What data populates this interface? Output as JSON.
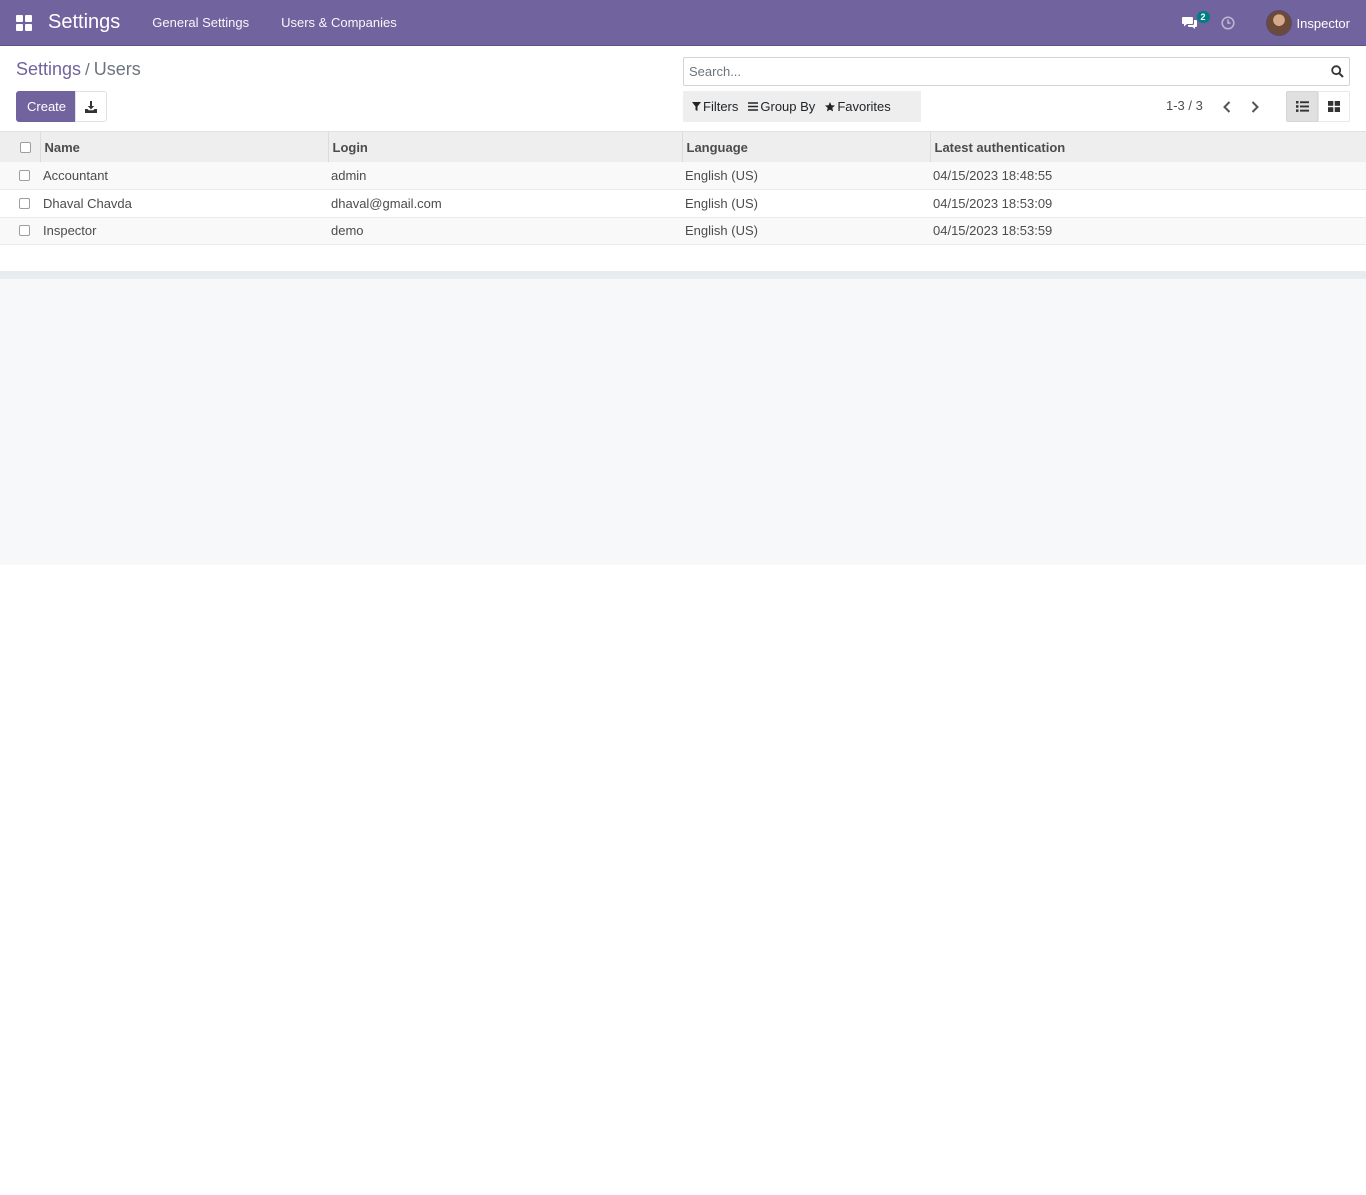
{
  "navbar": {
    "app_title": "Settings",
    "menu": [
      "General Settings",
      "Users & Companies"
    ],
    "messages_count": "2",
    "user_name": "Inspector",
    "icons": [
      "apps-grid-icon",
      "chat-icon",
      "clock-icon"
    ]
  },
  "breadcrumb": {
    "parent": "Settings",
    "separator": "/",
    "current": "Users"
  },
  "toolbar": {
    "create_label": "Create",
    "download_icon": "download-icon"
  },
  "search": {
    "placeholder": "Search...",
    "value": ""
  },
  "filters": {
    "filters_label": "Filters",
    "group_by_label": "Group By",
    "favorites_label": "Favorites"
  },
  "pager": {
    "text": "1-3 / 3"
  },
  "table": {
    "columns": [
      "Name",
      "Login",
      "Language",
      "Latest authentication"
    ],
    "rows": [
      {
        "name": "Accountant",
        "login": "admin",
        "language": "English (US)",
        "latest_auth": "04/15/2023 18:48:55"
      },
      {
        "name": "Dhaval Chavda",
        "login": "dhaval@gmail.com",
        "language": "English (US)",
        "latest_auth": "04/15/2023 18:53:09"
      },
      {
        "name": "Inspector",
        "login": "demo",
        "language": "English (US)",
        "latest_auth": "04/15/2023 18:53:59"
      }
    ]
  },
  "colors": {
    "brand": "#71639e",
    "badge": "#017e84"
  }
}
